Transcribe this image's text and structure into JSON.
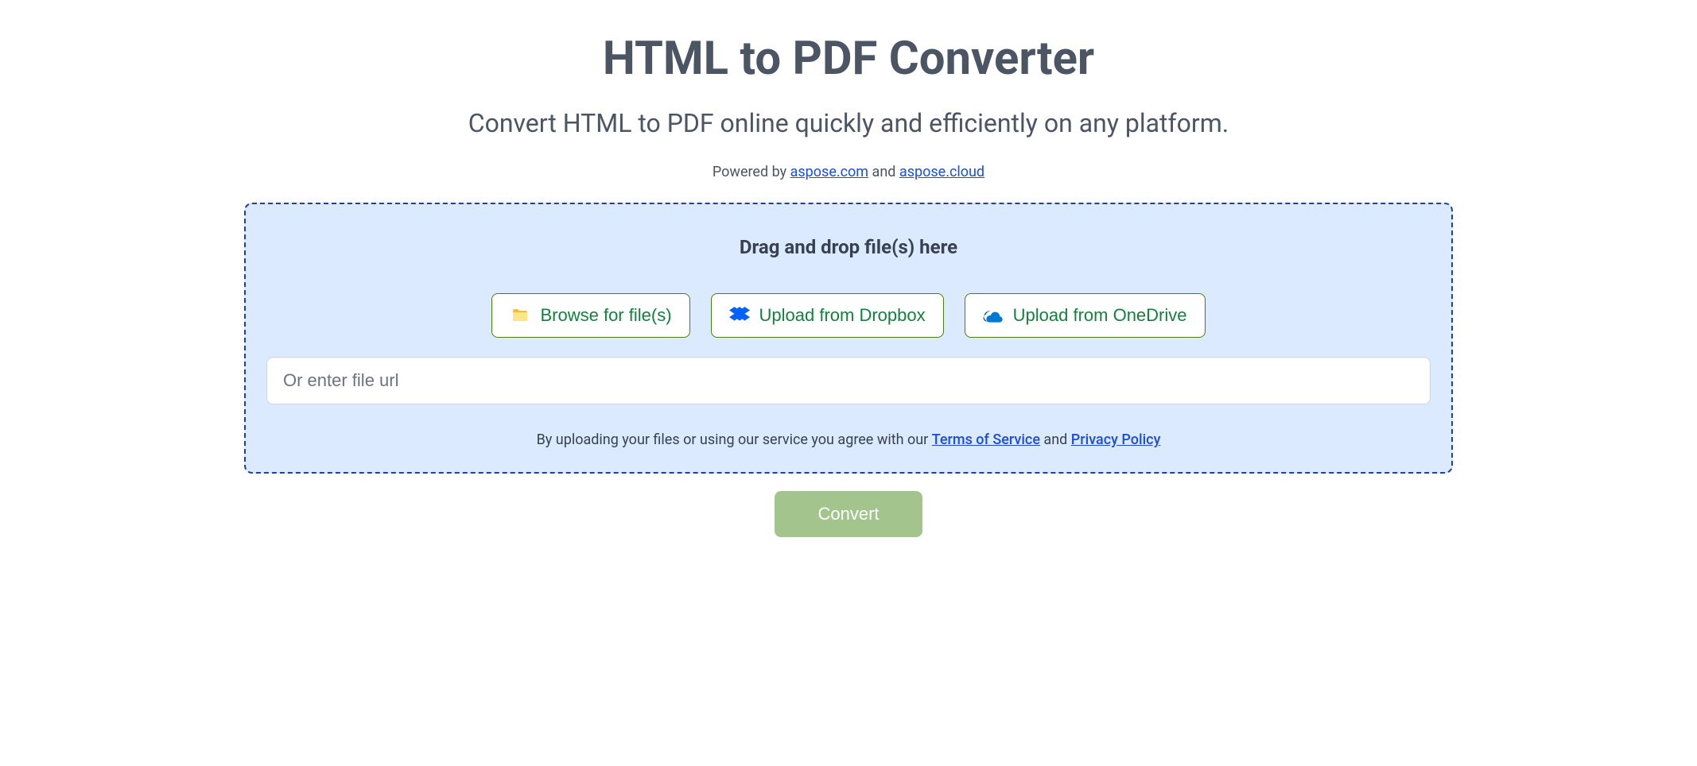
{
  "header": {
    "title": "HTML to PDF Converter",
    "subtitle": "Convert HTML to PDF online quickly and efficiently on any platform.",
    "powered_prefix": "Powered by ",
    "powered_link1": "aspose.com",
    "powered_mid": " and ",
    "powered_link2": "aspose.cloud"
  },
  "dropzone": {
    "heading": "Drag and drop file(s) here",
    "browse_label": "Browse for file(s)",
    "dropbox_label": "Upload from Dropbox",
    "onedrive_label": "Upload from OneDrive",
    "url_placeholder": "Or enter file url",
    "terms_prefix": "By uploading your files or using our service you agree with our ",
    "terms_link": "Terms of Service",
    "terms_mid": " and ",
    "privacy_link": "Privacy Policy"
  },
  "actions": {
    "convert_label": "Convert"
  }
}
